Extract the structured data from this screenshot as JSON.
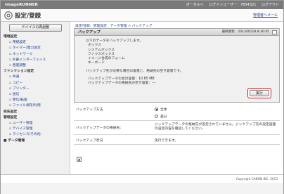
{
  "topbar": {
    "logo": "imageRUNNER",
    "links": [
      "ポータルへ",
      "ログインユーザー：7654321",
      "ログアウト"
    ]
  },
  "header": {
    "title": "設定/登録",
    "manager_link": "管理者へメール"
  },
  "sidebar": {
    "device_button": "デバイスの再起動",
    "items": [
      {
        "label": "環境設定",
        "type": "h"
      },
      {
        "label": "用紙設定",
        "type": "i"
      },
      {
        "label": "タイマー/電力設定",
        "type": "i"
      },
      {
        "label": "ネットワーク",
        "type": "i"
      },
      {
        "label": "外部インターフェイス",
        "type": "i"
      },
      {
        "label": "音量調整",
        "type": "i"
      },
      {
        "label": "ファンクション設定",
        "type": "h"
      },
      {
        "label": "共通",
        "type": "i"
      },
      {
        "label": "コピー",
        "type": "i"
      },
      {
        "label": "プリンター",
        "type": "i"
      },
      {
        "label": "送信",
        "type": "i"
      },
      {
        "label": "受信/転送",
        "type": "i"
      },
      {
        "label": "ファイル保存/利用",
        "type": "i"
      },
      {
        "label": "宛先設定",
        "type": "h"
      },
      {
        "label": "管理設定",
        "type": "h"
      },
      {
        "label": "ユーザー管理",
        "type": "i"
      },
      {
        "label": "デバイス管理",
        "type": "i"
      },
      {
        "label": "ライセンス/その他",
        "type": "i"
      },
      {
        "label": "データ管理",
        "type": "sel"
      }
    ]
  },
  "breadcrumb": "設定/登録：管理設定：データ管理 > バックアップ",
  "panel": {
    "title": "バックアップ",
    "timestamp": "最終更新：2013/05/18 8:30:45",
    "intro": "以下のデータをバックアップします。",
    "items": [
      "ボックス",
      "システムボックス",
      "ファクスボックス",
      "イメージ合成のフォーム",
      "キーボード"
    ],
    "note": "バックアップ先が必要な場合の容量と、格納先の空き容量です。",
    "size_label": "バックアップデータの合計容量：10.65 MB",
    "free_label": "バックアップデータの格納先の空き容量：---",
    "run_button": "実行"
  },
  "form": {
    "rows": [
      {
        "label": "バックアップ方法",
        "options": [
          {
            "label": "全体",
            "checked": true
          },
          {
            "label": "差分",
            "checked": false
          }
        ]
      },
      {
        "label": "バックアップデータの格納先：",
        "value": "ジックアップデータの格納先が設定されていません。ジックアップ先の設定画面の設定内容を確認してください。"
      },
      {
        "label": "バックアップ状況",
        "value": "実行できます。"
      }
    ]
  },
  "footer": {
    "copyright": "Copyright CANON INC. 2013"
  }
}
